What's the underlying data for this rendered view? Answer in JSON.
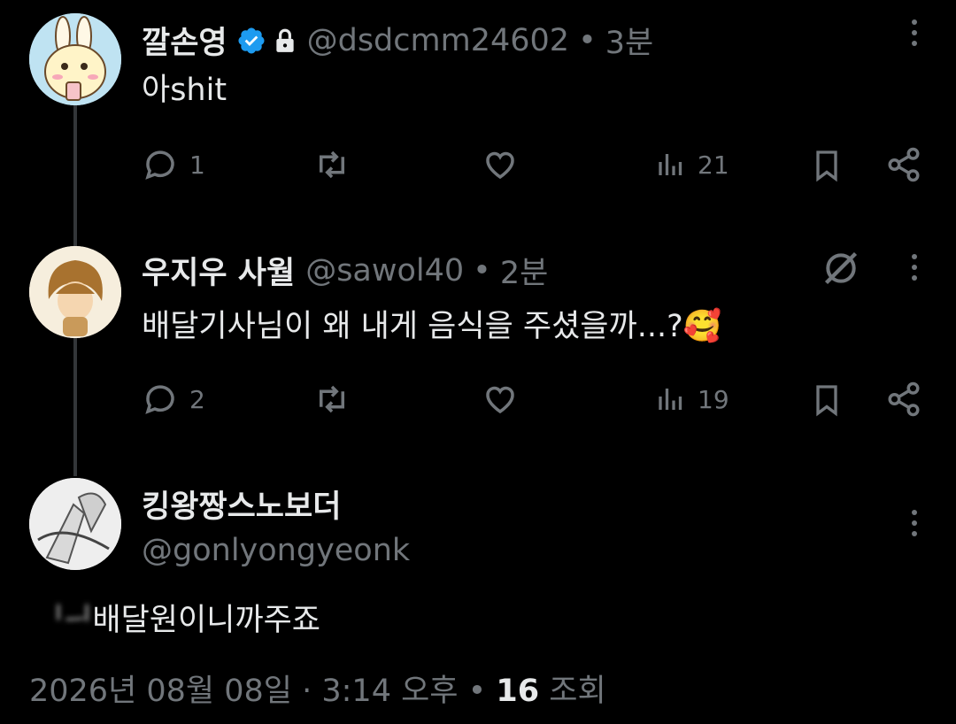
{
  "tweets": [
    {
      "name": "깔손영",
      "handle": "@dsdcmm24602",
      "time": "3분",
      "text": "아shit",
      "reply_count": "1",
      "view_count": "21"
    },
    {
      "name": "우지우 사월",
      "handle": "@sawol40",
      "time": "2분",
      "text": "배달기사님이 왜 내게 음식을 주셨을까...?🥰",
      "reply_count": "2",
      "view_count": "19"
    }
  ],
  "main_tweet": {
    "name": "킹왕짱스노보더",
    "handle": "@gonlyongyeonk",
    "text_prefix": "ᅵᅴ",
    "text": "배달원이니까주죠",
    "timestamp": "2026년 08월 08일 · 3:14 오후",
    "view_count": "16",
    "view_label": "조회"
  },
  "colors": {
    "background": "#000000",
    "text_primary": "#e7e9ea",
    "text_secondary": "#71767b",
    "verified_blue": "#1d9bf0",
    "thread_line": "#333639"
  },
  "icons": [
    "verified-badge-icon",
    "lock-icon",
    "reply-icon",
    "retweet-icon",
    "like-icon",
    "views-icon",
    "bookmark-icon",
    "share-icon",
    "more-icon",
    "grok-icon"
  ]
}
